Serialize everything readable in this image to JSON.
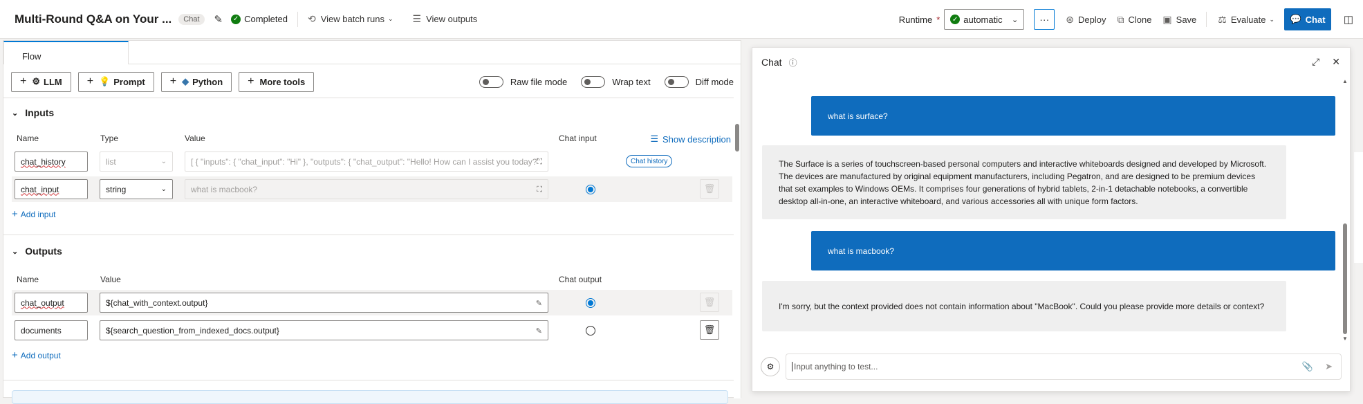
{
  "header": {
    "title": "Multi-Round Q&A on Your ...",
    "type_badge": "Chat",
    "status": "Completed",
    "view_batch_runs": "View batch runs",
    "view_outputs": "View outputs",
    "runtime_label": "Runtime",
    "runtime_required": "*",
    "runtime_value": "automatic",
    "more_label": "···",
    "deploy": "Deploy",
    "clone": "Clone",
    "save": "Save",
    "evaluate": "Evaluate",
    "chat": "Chat"
  },
  "flow": {
    "tab_label": "Flow",
    "tools": [
      "LLM",
      "Prompt",
      "Python",
      "More tools"
    ],
    "toggles": [
      "Raw file mode",
      "Wrap text",
      "Diff mode"
    ],
    "inputs": {
      "title": "Inputs",
      "col_name": "Name",
      "col_type": "Type",
      "col_value": "Value",
      "col_chat_input": "Chat input",
      "show_description": "Show description",
      "rows": [
        {
          "name": "chat_history",
          "type": "list",
          "value": "[ {    \"inputs\": {      \"chat_input\": \"Hi\"    },    \"outputs\": {      \"chat_output\": \"Hello! How can I assist you today?\"",
          "badge": "Chat history",
          "chat_input": false
        },
        {
          "name": "chat_input",
          "type": "string",
          "placeholder": "what is macbook?",
          "chat_input": true
        }
      ],
      "add_label": "Add input"
    },
    "outputs": {
      "title": "Outputs",
      "col_name": "Name",
      "col_value": "Value",
      "col_chat_output": "Chat output",
      "rows": [
        {
          "name": "chat_output",
          "value": "${chat_with_context.output}",
          "chat_output": true
        },
        {
          "name": "documents",
          "value": "${search_question_from_indexed_docs.output}",
          "chat_output": false
        }
      ],
      "add_label": "Add output"
    }
  },
  "chat": {
    "title": "Chat",
    "messages": [
      {
        "role": "user",
        "text": "what is surface?"
      },
      {
        "role": "bot",
        "text": "The Surface is a series of touchscreen-based personal computers and interactive whiteboards designed and developed by Microsoft. The devices are manufactured by original equipment manufacturers, including Pegatron, and are designed to be premium devices that set examples to Windows OEMs. It comprises four generations of hybrid tablets, 2-in-1 detachable notebooks, a convertible desktop all-in-one, an interactive whiteboard, and various accessories all with unique form factors."
      },
      {
        "role": "user",
        "text": "what is macbook?"
      },
      {
        "role": "bot",
        "text": "I'm sorry, but the context provided does not contain information about \"MacBook\". Could you please provide more details or context?"
      }
    ],
    "input_placeholder": "Input anything to test..."
  },
  "colors": {
    "accent": "#0f6cbd",
    "success": "#107c10",
    "user_bubble": "#0f6cbd",
    "bot_bubble": "#efefef"
  },
  "icons": [
    "edit-icon",
    "check-circle-icon",
    "history-icon",
    "list-icon",
    "more-icon",
    "deploy-icon",
    "clone-icon",
    "save-icon",
    "evaluate-icon",
    "chat-icon",
    "side-panel-icon",
    "info-icon",
    "expand-icon",
    "close-icon",
    "attach-icon",
    "send-icon",
    "trash-icon"
  ]
}
